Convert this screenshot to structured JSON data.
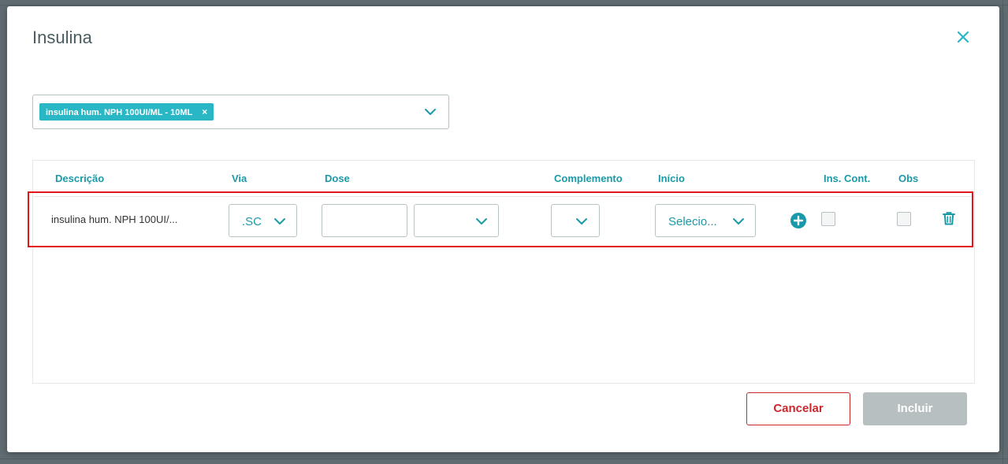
{
  "modal": {
    "title": "Insulina",
    "close_icon": "close-icon"
  },
  "medication_select": {
    "selected_tag": "insulina hum. NPH 100UI/ML - 10ML",
    "remove_icon": "×",
    "chevron_icon": "chevron-down-icon"
  },
  "table": {
    "headers": {
      "descricao": "Descrição",
      "via": "Via",
      "dose": "Dose",
      "complemento": "Complemento",
      "inicio": "Início",
      "ins_cont": "Ins. Cont.",
      "obs": "Obs"
    },
    "rows": [
      {
        "descricao": "insulina hum. NPH 100UI/...",
        "via": ".SC",
        "dose_value": "",
        "dose_unit": "",
        "complemento": "",
        "inicio": "Selecio...",
        "ins_cont_checked": false,
        "obs_checked": false
      }
    ]
  },
  "footer": {
    "cancel_label": "Cancelar",
    "include_label": "Incluir"
  },
  "colors": {
    "accent": "#29b6c5",
    "danger": "#c9282d",
    "disabled": "#b7bfc1",
    "highlight": "#e0161b"
  }
}
